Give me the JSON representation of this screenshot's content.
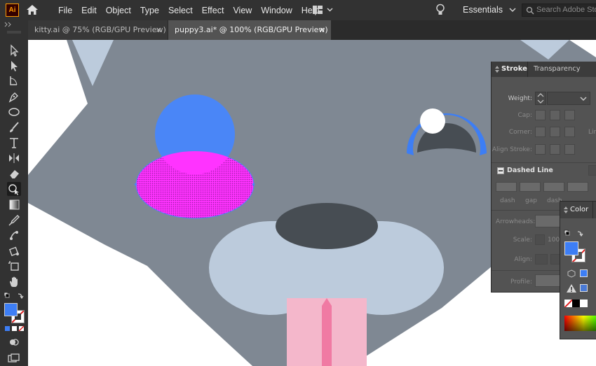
{
  "app": {
    "logo": "Ai"
  },
  "menu": [
    "File",
    "Edit",
    "Object",
    "Type",
    "Select",
    "Effect",
    "View",
    "Window",
    "Help"
  ],
  "workspace": {
    "label": "Essentials"
  },
  "search": {
    "placeholder": "Search Adobe Stock"
  },
  "tabs": [
    {
      "label": "kitty.ai @ 75% (RGB/GPU Preview)",
      "close": "×"
    },
    {
      "label": "puppy3.ai* @ 100% (RGB/GPU Preview)",
      "close": "×"
    }
  ],
  "tools": [
    "selection-tool",
    "direct-selection-tool",
    "curvature-tool",
    "pen-tool",
    "ellipse-tool",
    "paintbrush-tool",
    "type-tool",
    "width-tool",
    "eraser-tool",
    "shape-builder-tool",
    "gradient-tool",
    "eyedropper-tool",
    "puppet-warp-tool",
    "live-paint-tool",
    "artboard-tool",
    "hand-tool"
  ],
  "colors": {
    "fill": "#3d7ef5",
    "blue_circle": "#4a86f7",
    "magenta": "#ff33ff",
    "face": "#7f8893",
    "muzzle": "#bccbdc",
    "nose": "#474d53",
    "tongue": "#f4b7cb",
    "tongue_line": "#f07aa3",
    "eye_dark": "#474d53",
    "eye_ring": "#3d7ef5"
  },
  "stroke_panel": {
    "tab_stroke": "Stroke",
    "tab_transparency": "Transparency",
    "weight_label": "Weight:",
    "cap_label": "Cap:",
    "corner_label": "Corner:",
    "align_label": "Align Stroke:",
    "dashed_label": "Dashed Line",
    "dash1": "dash",
    "gap1": "gap",
    "dash2": "dash",
    "arrowheads_label": "Arrowheads:",
    "scale_label": "Scale:",
    "scale_value": "100%",
    "align2_label": "Align:",
    "profile_label": "Profile:",
    "limit_fragment": "Lir"
  },
  "color_panel": {
    "title": "Color"
  }
}
